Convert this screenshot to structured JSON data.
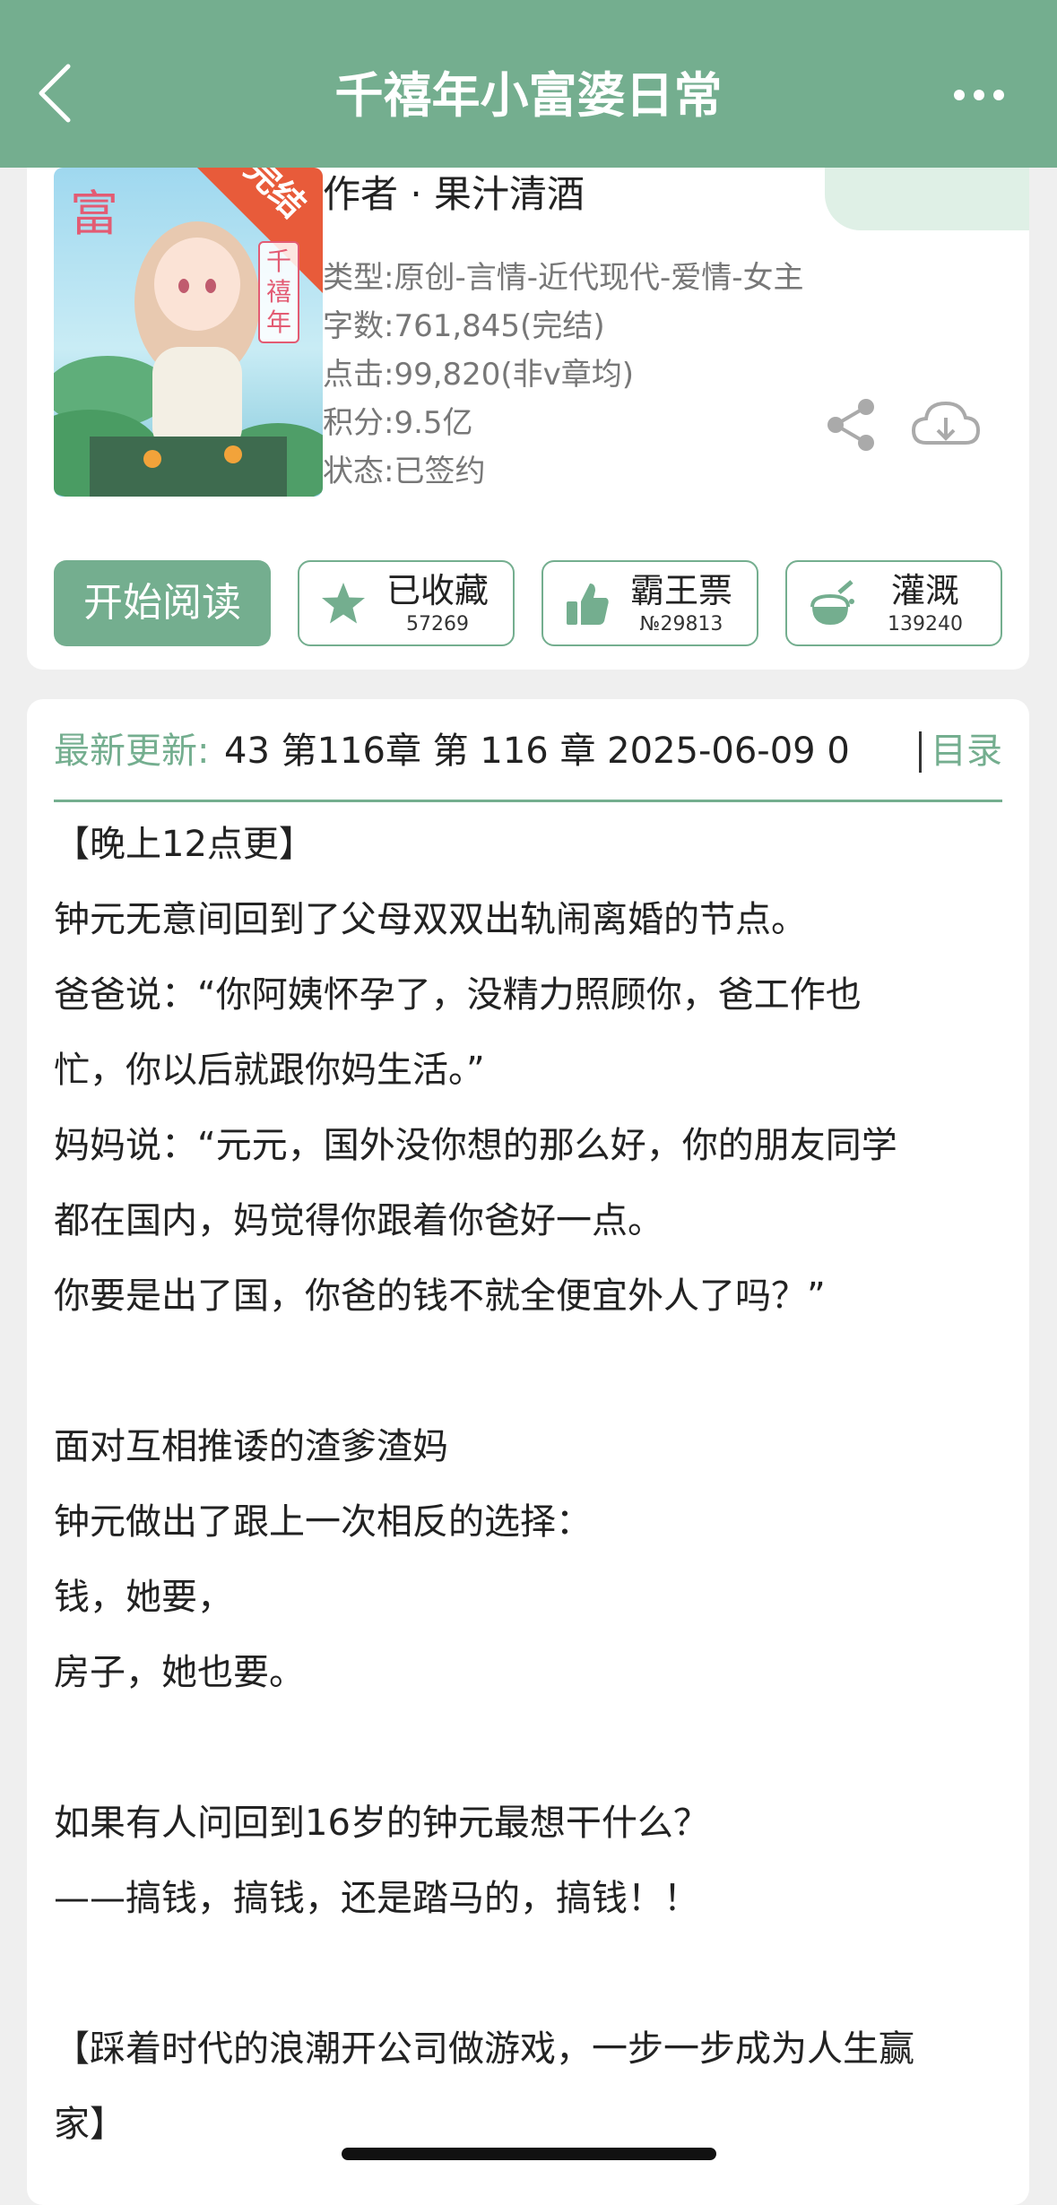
{
  "nav": {
    "title": "千禧年小富婆日常",
    "back_icon": "chevron-left-icon",
    "more_icon": "more-dots-icon"
  },
  "colors": {
    "accent": "#74ae8f",
    "navbar": "#74ae8f",
    "page_bg": "#efefef"
  },
  "book": {
    "cover_badge": "完结",
    "cover_vertical_title": "千禧年",
    "author": "作者 · 果汁清酒",
    "meta": [
      "类型:原创-言情-近代现代-爱情-女主",
      "字数:761,845(完结)",
      "点击:99,820(非v章均)",
      "积分:9.5亿",
      "状态:已签约"
    ]
  },
  "actions": {
    "read_label": "开始阅读",
    "favorite": {
      "label": "已收藏",
      "count": "57269",
      "icon": "star-icon"
    },
    "ticket": {
      "label": "霸王票",
      "count": "№29813",
      "icon": "thumbs-up-icon"
    },
    "water": {
      "label": "灌溉",
      "count": "139240",
      "icon": "watering-flask-icon"
    },
    "share_icon": "share-icon",
    "download_icon": "cloud-download-icon"
  },
  "update": {
    "label": "最新更新:",
    "text": "43  第116章 第 116 章 2025-06-09 0",
    "toc_label": "目录"
  },
  "intro": [
    "【晚上12点更】",
    "钟元无意间回到了父母双双出轨闹离婚的节点。",
    "爸爸说：“你阿姨怀孕了，没精力照顾你，爸工作也",
    "忙，你以后就跟你妈生活。”",
    "妈妈说：“元元，国外没你想的那么好，你的朋友同学",
    "都在国内，妈觉得你跟着你爸好一点。",
    "你要是出了国，你爸的钱不就全便宜外人了吗？”",
    "",
    "面对互相推诿的渣爹渣妈",
    "钟元做出了跟上一次相反的选择：",
    "钱，她要，",
    "房子，她也要。",
    "",
    "如果有人问回到16岁的钟元最想干什么？",
    "——搞钱，搞钱，还是踏马的，搞钱！！",
    "",
    "【踩着时代的浪潮开公司做游戏，一步一步成为人生赢",
    "家】"
  ]
}
